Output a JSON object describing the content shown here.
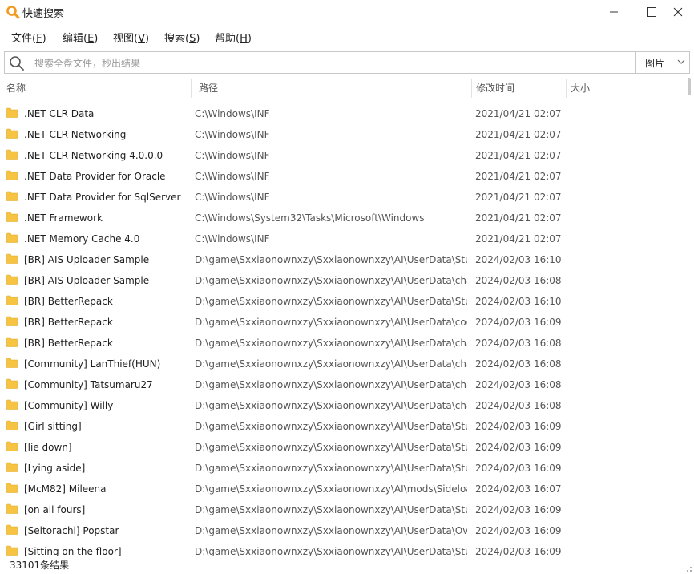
{
  "window": {
    "title": "快速搜索"
  },
  "menu": [
    {
      "label": "文件(",
      "key": "F",
      "end": ")"
    },
    {
      "label": "编辑(",
      "key": "E",
      "end": ")"
    },
    {
      "label": "视图(",
      "key": "V",
      "end": ")"
    },
    {
      "label": "搜索(",
      "key": "S",
      "end": ")"
    },
    {
      "label": "帮助(",
      "key": "H",
      "end": ")"
    }
  ],
  "search": {
    "placeholder": "搜索全盘文件，秒出结果",
    "value": "",
    "filter": "图片"
  },
  "columns": {
    "name": "名称",
    "path": "路径",
    "modified": "修改时间",
    "size": "大小"
  },
  "rows": [
    {
      "name": ".NET CLR Data",
      "path": "C:\\Windows\\INF",
      "modified": "2021/04/21 02:07"
    },
    {
      "name": ".NET CLR Networking",
      "path": "C:\\Windows\\INF",
      "modified": "2021/04/21 02:07"
    },
    {
      "name": ".NET CLR Networking 4.0.0.0",
      "path": "C:\\Windows\\INF",
      "modified": "2021/04/21 02:07"
    },
    {
      "name": ".NET Data Provider for Oracle",
      "path": "C:\\Windows\\INF",
      "modified": "2021/04/21 02:07"
    },
    {
      "name": ".NET Data Provider for SqlServer",
      "path": "C:\\Windows\\INF",
      "modified": "2021/04/21 02:07"
    },
    {
      "name": ".NET Framework",
      "path": "C:\\Windows\\System32\\Tasks\\Microsoft\\Windows",
      "modified": "2021/04/21 02:07"
    },
    {
      "name": ".NET Memory Cache 4.0",
      "path": "C:\\Windows\\INF",
      "modified": "2021/04/21 02:07"
    },
    {
      "name": "[BR] AIS Uploader Sample",
      "path": "D:\\game\\Sxxiaonownxzy\\Sxxiaonownxzy\\AI\\UserData\\Stud",
      "modified": "2024/02/03 16:10"
    },
    {
      "name": "[BR] AIS Uploader Sample",
      "path": "D:\\game\\Sxxiaonownxzy\\Sxxiaonownxzy\\AI\\UserData\\char",
      "modified": "2024/02/03 16:08"
    },
    {
      "name": "[BR] BetterRepack",
      "path": "D:\\game\\Sxxiaonownxzy\\Sxxiaonownxzy\\AI\\UserData\\Stud",
      "modified": "2024/02/03 16:10"
    },
    {
      "name": "[BR] BetterRepack",
      "path": "D:\\game\\Sxxiaonownxzy\\Sxxiaonownxzy\\AI\\UserData\\coor",
      "modified": "2024/02/03 16:09"
    },
    {
      "name": "[BR] BetterRepack",
      "path": "D:\\game\\Sxxiaonownxzy\\Sxxiaonownxzy\\AI\\UserData\\char",
      "modified": "2024/02/03 16:08"
    },
    {
      "name": "[Community] LanThief(HUN)",
      "path": "D:\\game\\Sxxiaonownxzy\\Sxxiaonownxzy\\AI\\UserData\\char",
      "modified": "2024/02/03 16:08"
    },
    {
      "name": "[Community] Tatsumaru27",
      "path": "D:\\game\\Sxxiaonownxzy\\Sxxiaonownxzy\\AI\\UserData\\char",
      "modified": "2024/02/03 16:08"
    },
    {
      "name": "[Community] Willy",
      "path": "D:\\game\\Sxxiaonownxzy\\Sxxiaonownxzy\\AI\\UserData\\char",
      "modified": "2024/02/03 16:08"
    },
    {
      "name": "[Girl sitting]",
      "path": "D:\\game\\Sxxiaonownxzy\\Sxxiaonownxzy\\AI\\UserData\\Stud",
      "modified": "2024/02/03 16:09"
    },
    {
      "name": "[lie down]",
      "path": "D:\\game\\Sxxiaonownxzy\\Sxxiaonownxzy\\AI\\UserData\\Stud",
      "modified": "2024/02/03 16:09"
    },
    {
      "name": "[Lying aside]",
      "path": "D:\\game\\Sxxiaonownxzy\\Sxxiaonownxzy\\AI\\UserData\\Stud",
      "modified": "2024/02/03 16:09"
    },
    {
      "name": "[McM82] Mileena",
      "path": "D:\\game\\Sxxiaonownxzy\\Sxxiaonownxzy\\AI\\mods\\Sideloa",
      "modified": "2024/02/03 16:07"
    },
    {
      "name": "[on all fours]",
      "path": "D:\\game\\Sxxiaonownxzy\\Sxxiaonownxzy\\AI\\UserData\\Stud",
      "modified": "2024/02/03 16:09"
    },
    {
      "name": "[Seitorachi] Popstar",
      "path": "D:\\game\\Sxxiaonownxzy\\Sxxiaonownxzy\\AI\\UserData\\Over",
      "modified": "2024/02/03 16:09"
    },
    {
      "name": "[Sitting on the floor]",
      "path": "D:\\game\\Sxxiaonownxzy\\Sxxiaonownxzy\\AI\\UserData\\Stud",
      "modified": "2024/02/03 16:09"
    }
  ],
  "status": {
    "count": "33101条结果"
  },
  "colors": {
    "folder": "#f6c343",
    "accent": "#f39a1e"
  },
  "icons": {
    "app": "magnifier-icon",
    "folder": "folder-icon"
  }
}
